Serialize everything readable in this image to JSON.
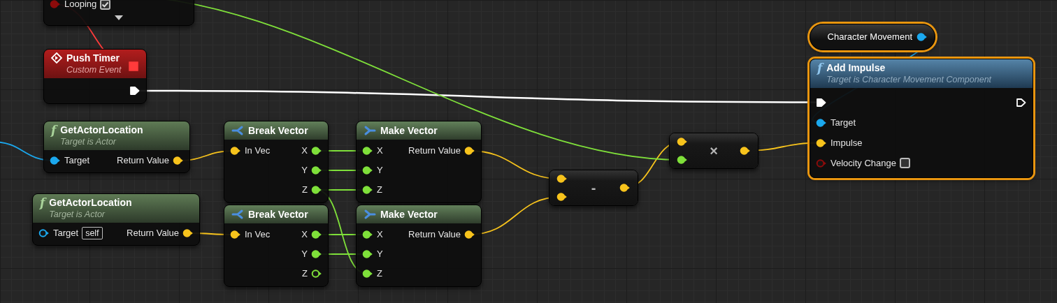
{
  "nodes": [
    {
      "kind": "fragment",
      "selected": false,
      "expandable": true,
      "rows": [
        {
          "in": {
            "label": "Looping",
            "kind": "data",
            "color": "#8c0b0b",
            "connected": true,
            "checked": true
          }
        }
      ]
    },
    {
      "kind": "event",
      "selected": false,
      "title": "Push Timer",
      "subtitle": "Custom Event",
      "delegate_pin": {
        "kind": "delegate",
        "color": "#ff3b3b",
        "connected": true
      },
      "rows": [
        {
          "out": {
            "kind": "exec",
            "color": "#ffffff",
            "connected": true
          }
        }
      ]
    },
    {
      "kind": "pure",
      "selected": false,
      "glyph": "f",
      "title": "GetActorLocation",
      "subtitle": "Target is Actor",
      "rows": [
        {
          "in": {
            "label": "Target",
            "kind": "data",
            "color": "#1ba8ee",
            "connected": true
          },
          "out": {
            "label": "Return Value",
            "kind": "data",
            "color": "#f7c31c",
            "connected": true
          }
        }
      ]
    },
    {
      "kind": "pure",
      "selected": false,
      "glyph": "f",
      "title": "GetActorLocation",
      "subtitle": "Target is Actor",
      "rows": [
        {
          "in": {
            "label": "Target",
            "kind": "data",
            "color": "#1ba8ee",
            "connected": false,
            "default": "self"
          },
          "out": {
            "label": "Return Value",
            "kind": "data",
            "color": "#f7c31c",
            "connected": true
          }
        }
      ]
    },
    {
      "kind": "break_struct",
      "selected": false,
      "title": "Break Vector",
      "rows": [
        {
          "in": {
            "label": "In Vec",
            "kind": "data",
            "color": "#f7c31c",
            "connected": true
          },
          "out": {
            "label": "X",
            "kind": "data",
            "color": "#7fe03a",
            "connected": true
          }
        },
        {
          "out": {
            "label": "Y",
            "kind": "data",
            "color": "#7fe03a",
            "connected": true
          }
        },
        {
          "out": {
            "label": "Z",
            "kind": "data",
            "color": "#7fe03a",
            "connected": true
          }
        }
      ]
    },
    {
      "kind": "break_struct",
      "selected": false,
      "title": "Break Vector",
      "rows": [
        {
          "in": {
            "label": "In Vec",
            "kind": "data",
            "color": "#f7c31c",
            "connected": true
          },
          "out": {
            "label": "X",
            "kind": "data",
            "color": "#7fe03a",
            "connected": true
          }
        },
        {
          "out": {
            "label": "Y",
            "kind": "data",
            "color": "#7fe03a",
            "connected": true
          }
        },
        {
          "out": {
            "label": "Z",
            "kind": "data",
            "color": "#7fe03a",
            "connected": false
          }
        }
      ]
    },
    {
      "kind": "make_struct",
      "selected": false,
      "title": "Make Vector",
      "rows": [
        {
          "in": {
            "label": "X",
            "kind": "data",
            "color": "#7fe03a",
            "connected": true
          },
          "out": {
            "label": "Return Value",
            "kind": "data",
            "color": "#f7c31c",
            "connected": true
          }
        },
        {
          "in": {
            "label": "Y",
            "kind": "data",
            "color": "#7fe03a",
            "connected": true
          }
        },
        {
          "in": {
            "label": "Z",
            "kind": "data",
            "color": "#7fe03a",
            "connected": true
          }
        }
      ]
    },
    {
      "kind": "make_struct",
      "selected": false,
      "title": "Make Vector",
      "rows": [
        {
          "in": {
            "label": "X",
            "kind": "data",
            "color": "#7fe03a",
            "connected": true
          },
          "out": {
            "label": "Return Value",
            "kind": "data",
            "color": "#f7c31c",
            "connected": true
          }
        },
        {
          "in": {
            "label": "Y",
            "kind": "data",
            "color": "#7fe03a",
            "connected": true
          }
        },
        {
          "in": {
            "label": "Z",
            "kind": "data",
            "color": "#7fe03a",
            "connected": true
          }
        }
      ]
    },
    {
      "kind": "operator",
      "selected": false,
      "symbol": "-",
      "inputs": [
        {
          "kind": "data",
          "color": "#f7c31c",
          "connected": true
        },
        {
          "kind": "data",
          "color": "#f7c31c",
          "connected": true
        }
      ],
      "output": {
        "kind": "data",
        "color": "#f7c31c",
        "connected": true
      }
    },
    {
      "kind": "operator",
      "selected": false,
      "symbol": "×",
      "inputs": [
        {
          "kind": "data",
          "color": "#f7c31c",
          "connected": true
        },
        {
          "kind": "data",
          "color": "#7fe03a",
          "connected": true
        }
      ],
      "output": {
        "kind": "data",
        "color": "#f7c31c",
        "connected": true
      }
    },
    {
      "kind": "variable",
      "selected": true,
      "title": "Character Movement",
      "output": {
        "kind": "data",
        "color": "#1ba8ee",
        "connected": true
      }
    },
    {
      "kind": "call",
      "selected": true,
      "glyph": "f",
      "title": "Add Impulse",
      "subtitle": "Target is Character Movement Component",
      "rows": [
        {
          "in": {
            "kind": "exec",
            "color": "#ffffff",
            "connected": true
          },
          "out": {
            "kind": "exec",
            "color": "#ffffff",
            "connected": false
          }
        },
        {
          "in": {
            "label": "Target",
            "kind": "data",
            "color": "#1ba8ee",
            "connected": true
          }
        },
        {
          "in": {
            "label": "Impulse",
            "kind": "data",
            "color": "#f7c31c",
            "connected": true
          }
        },
        {
          "in": {
            "label": "Velocity Change",
            "kind": "data",
            "color": "#8c0b0b",
            "connected": false,
            "checked": false
          }
        }
      ]
    }
  ]
}
